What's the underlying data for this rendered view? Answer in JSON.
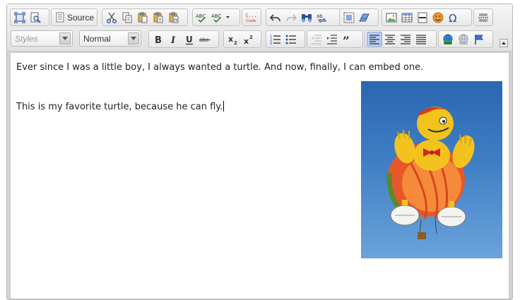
{
  "toolbar": {
    "source_label": "Source",
    "styles_placeholder": "Styles",
    "format_value": "Normal",
    "spell_a_label": "ABC",
    "spell_b_label": "ABC",
    "codesnippet_label": "{...} Code"
  },
  "content": {
    "paragraph_1": "Ever since I was a little boy, I always wanted a turtle. And now, finally, I can embed one.",
    "paragraph_2": "This is my favorite turtle, because he can fly."
  },
  "colors": {
    "accent_active": "#b9cdf3",
    "icon_blue": "#3b5fa8",
    "icon_red": "#c82a2a"
  },
  "icons": [
    "maximize-icon",
    "preview-icon",
    "source-icon",
    "cut-icon",
    "copy-icon",
    "paste-icon",
    "paste-text-icon",
    "paste-word-icon",
    "spellcheck-icon",
    "scayt-icon",
    "code-snippet-icon",
    "undo-icon",
    "redo-icon",
    "find-icon",
    "replace-icon",
    "select-all-icon",
    "remove-format-icon",
    "image-icon",
    "table-icon",
    "horizontal-rule-icon",
    "smiley-icon",
    "special-char-icon",
    "page-break-icon",
    "bold-icon",
    "italic-icon",
    "underline-icon",
    "strike-icon",
    "subscript-icon",
    "superscript-icon",
    "numbered-list-icon",
    "bulleted-list-icon",
    "outdent-icon",
    "indent-icon",
    "blockquote-icon",
    "align-left-icon",
    "align-center-icon",
    "align-right-icon",
    "justify-icon",
    "link-icon",
    "unlink-icon",
    "anchor-icon"
  ]
}
